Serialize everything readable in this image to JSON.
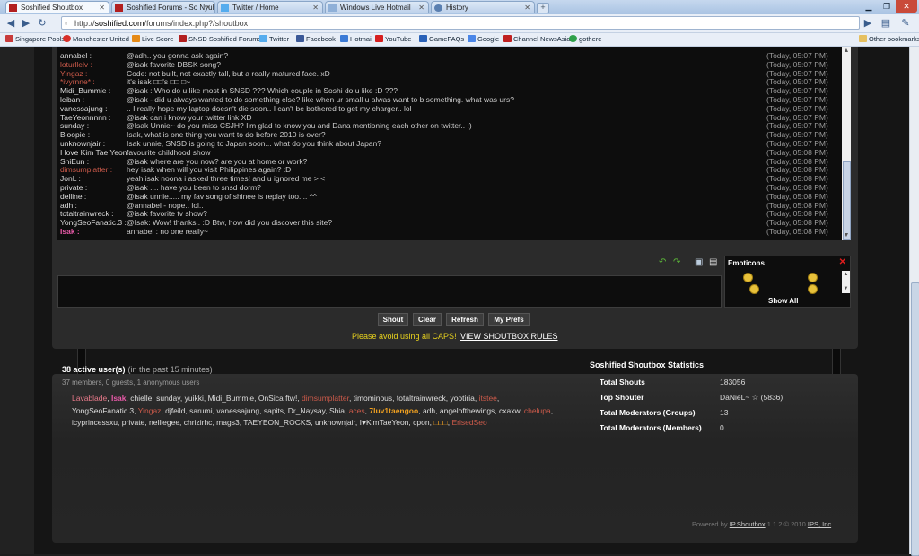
{
  "browser": {
    "tabs": [
      {
        "label": "Soshified Shoutbox",
        "active": true
      },
      {
        "label": "Soshified Forums - So Nyuh...",
        "active": false
      },
      {
        "label": "Twitter / Home",
        "active": false
      },
      {
        "label": "Windows Live Hotmail",
        "active": false
      },
      {
        "label": "History",
        "active": false
      }
    ],
    "new_tab": "+",
    "url_prefix": "http://",
    "url_domain": "soshified.com",
    "url_path": "/forums/index.php?/shoutbox",
    "bookmarks": [
      {
        "label": "Singapore Pools",
        "icon": "singapore-pools-icon",
        "color": "#c83b3b"
      },
      {
        "label": "Manchester United",
        "icon": "man-utd-icon",
        "color": "#d8302a"
      },
      {
        "label": "Live Score",
        "icon": "live-score-icon",
        "color": "#e58a17"
      },
      {
        "label": "SNSD Soshified Forums",
        "icon": "soshified-icon",
        "color": "#b21f1f"
      },
      {
        "label": "Twitter",
        "icon": "twitter-icon",
        "color": "#55acee"
      },
      {
        "label": "Facebook",
        "icon": "facebook-icon",
        "color": "#3b5998"
      },
      {
        "label": "Hotmail",
        "icon": "hotmail-icon",
        "color": "#3c7bd6"
      },
      {
        "label": "YouTube",
        "icon": "youtube-icon",
        "color": "#d61f1f"
      },
      {
        "label": "GameFAQs",
        "icon": "gamefaqs-icon",
        "color": "#2a62b8"
      },
      {
        "label": "Google",
        "icon": "google-icon",
        "color": "#4a86e8"
      },
      {
        "label": "Channel NewsAsia",
        "icon": "channel-newsasia-icon",
        "color": "#c02020"
      },
      {
        "label": "gothere",
        "icon": "gothere-icon",
        "color": "#2ea04a"
      }
    ],
    "other_bookmarks": "Other bookmarks"
  },
  "shoutbox": {
    "rows": [
      {
        "user": "annabel :",
        "msg": "@adh.. you gonna ask again?",
        "time": "(Today, 05:07 PM)",
        "color": "#dddddd"
      },
      {
        "user": "loturllelv :",
        "msg": "@isak favorite DBSK song?",
        "time": "(Today, 05:07 PM)",
        "color": "#cc5a4a"
      },
      {
        "user": "Yingaz :",
        "msg": "Code: not built, not exactly tall, but a really matured face. xD",
        "time": "(Today, 05:07 PM)",
        "color": "#cc5a4a"
      },
      {
        "user": "*ivyrnne* :",
        "msg": "it's isak □□'s □□ □~",
        "time": "(Today, 05:07 PM)",
        "color": "#cc5a4a"
      },
      {
        "user": "Midi_Bummie :",
        "msg": "@isak : Who do u like most in SNSD ??? Which couple in Soshi do u like :D ???",
        "time": "(Today, 05:07 PM)",
        "color": "#dddddd"
      },
      {
        "user": "lciban :",
        "msg": "@isak - did u always wanted to do something else? like when ur small u alwas want to b something. what was urs?",
        "time": "(Today, 05:07 PM)",
        "color": "#dddddd"
      },
      {
        "user": "vanessajung :",
        "msg": ".. I really hope my laptop doesn't die soon.. I can't be bothered to get my charger.. lol",
        "time": "(Today, 05:07 PM)",
        "color": "#dddddd"
      },
      {
        "user": "TaeYeonnnnn :",
        "msg": "@isak can i know your twitter link XD",
        "time": "(Today, 05:07 PM)",
        "color": "#dddddd"
      },
      {
        "user": "sunday :",
        "msg": "@Isak Unnie~ do you miss CSJH? I'm glad to know you and Dana mentioning each other on twitter.. :)",
        "time": "(Today, 05:07 PM)",
        "color": "#dddddd"
      },
      {
        "user": "Bloopie :",
        "msg": "Isak, what is one thing you want to do before 2010 is over?",
        "time": "(Today, 05:07 PM)",
        "color": "#dddddd"
      },
      {
        "user": "unknownjair :",
        "msg": "Isak unnie, SNSD is going to Japan soon... what do you think about Japan?",
        "time": "(Today, 05:07 PM)",
        "color": "#dddddd"
      },
      {
        "user": "I love Kim Tae Yeon :",
        "msg": "favourite childhood show",
        "time": "(Today, 05:08 PM)",
        "color": "#dddddd"
      },
      {
        "user": "ShiEun :",
        "msg": "@isak where are you now? are you at home or work?",
        "time": "(Today, 05:08 PM)",
        "color": "#dddddd"
      },
      {
        "user": "dimsumplatter :",
        "msg": "hey isak when will you visit Philippines again? :D",
        "time": "(Today, 05:08 PM)",
        "color": "#cc5a4a"
      },
      {
        "user": "JonL :",
        "msg": "yeah isak noona i asked three times! and u ignored me > <",
        "time": "(Today, 05:08 PM)",
        "color": "#dddddd"
      },
      {
        "user": "private :",
        "msg": "@isak .... have you been to snsd dorm?",
        "time": "(Today, 05:08 PM)",
        "color": "#dddddd"
      },
      {
        "user": "delline :",
        "msg": "@isak unnie..... my fav song of shinee is replay too.... ^^",
        "time": "(Today, 05:08 PM)",
        "color": "#dddddd"
      },
      {
        "user": "adh :",
        "msg": "@annabel - nope.. lol..",
        "time": "(Today, 05:08 PM)",
        "color": "#dddddd"
      },
      {
        "user": "totaltrainwreck :",
        "msg": "@isak favorite tv show?",
        "time": "(Today, 05:08 PM)",
        "color": "#dddddd"
      },
      {
        "user": "YongSeoFanatic.3 :",
        "msg": "@Isak: Wow! thanks.. :D Btw, how did you discover this site?",
        "time": "(Today, 05:08 PM)",
        "color": "#dddddd"
      },
      {
        "user": "Isak :",
        "msg": "annabel : no one really~",
        "time": "(Today, 05:08 PM)",
        "color": "#e85aa8"
      }
    ],
    "emoticons_title": "Emoticons",
    "show_all": "Show All",
    "buttons": {
      "shout": "Shout",
      "clear": "Clear",
      "refresh": "Refresh",
      "prefs": "My Prefs"
    },
    "warning": "Please avoid using all CAPS!",
    "rules_link": "VIEW SHOUTBOX RULES"
  },
  "online": {
    "active_count": "38 active user(s)",
    "active_note": "(in the past 15 minutes)",
    "breakdown": "37 members, 0 guests, 1 anonymous users",
    "users": [
      {
        "name": "Lavablade",
        "color": "#e87a8a"
      },
      {
        "name": "Isak",
        "color": "#e85aa8"
      },
      {
        "name": "chielle",
        "color": "#dddddd"
      },
      {
        "name": "sunday",
        "color": "#dddddd"
      },
      {
        "name": "yuikki",
        "color": "#dddddd"
      },
      {
        "name": "Midi_Bummie",
        "color": "#dddddd"
      },
      {
        "name": "OnSica ftw!",
        "color": "#dddddd"
      },
      {
        "name": "dimsumplatter",
        "color": "#cc5a4a"
      },
      {
        "name": "timominous",
        "color": "#dddddd"
      },
      {
        "name": "totaltrainwreck",
        "color": "#dddddd"
      },
      {
        "name": "yootiria",
        "color": "#dddddd"
      },
      {
        "name": "itstee",
        "color": "#cc5a4a"
      },
      {
        "name": "YongSeoFanatic.3",
        "color": "#dddddd"
      },
      {
        "name": "Yingaz",
        "color": "#cc5a4a"
      },
      {
        "name": "djfeild",
        "color": "#dddddd"
      },
      {
        "name": "sarumi",
        "color": "#dddddd"
      },
      {
        "name": "vanessajung",
        "color": "#dddddd"
      },
      {
        "name": "sapits",
        "color": "#dddddd"
      },
      {
        "name": "Dr_Naysay",
        "color": "#dddddd"
      },
      {
        "name": "Shia",
        "color": "#dddddd"
      },
      {
        "name": "aces",
        "color": "#cc5a4a"
      },
      {
        "name": "7luv1taengoo",
        "color": "#f0a020"
      },
      {
        "name": "adh",
        "color": "#dddddd"
      },
      {
        "name": "angelofthewings",
        "color": "#dddddd"
      },
      {
        "name": "cxaxw",
        "color": "#dddddd"
      },
      {
        "name": "chelupa",
        "color": "#cc5a4a"
      },
      {
        "name": "icyprincessxu",
        "color": "#dddddd"
      },
      {
        "name": "private",
        "color": "#dddddd"
      },
      {
        "name": "nelliegee",
        "color": "#dddddd"
      },
      {
        "name": "chrizirhc",
        "color": "#dddddd"
      },
      {
        "name": "mags3",
        "color": "#dddddd"
      },
      {
        "name": "TAEYEON_ROCKS",
        "color": "#dddddd"
      },
      {
        "name": "unknownjair",
        "color": "#dddddd"
      },
      {
        "name": "I♥KimTaeYeon",
        "color": "#dddddd"
      },
      {
        "name": "cpon",
        "color": "#dddddd"
      },
      {
        "name": "□□□",
        "color": "#f0a020"
      },
      {
        "name": "ErisedSeo",
        "color": "#cc5a4a"
      }
    ]
  },
  "stats": {
    "title": "Soshified Shoutbox Statistics",
    "items": [
      {
        "label": "Total Shouts",
        "value": "183056"
      },
      {
        "label": "Top Shouter",
        "value": "DaNieL~ ☆ (5836)"
      },
      {
        "label": "Total Moderators (Groups)",
        "value": "13"
      },
      {
        "label": "Total Moderators (Members)",
        "value": "0"
      }
    ],
    "powered_prefix": "Powered by",
    "powered_product": "IP.Shoutbox",
    "powered_version": "1.1.2 © 2010",
    "powered_company": "IPS, Inc"
  }
}
